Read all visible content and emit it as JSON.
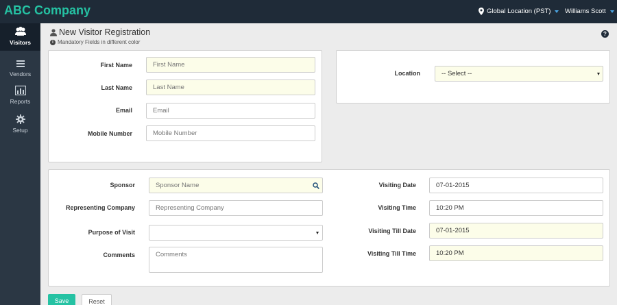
{
  "header": {
    "brand": "ABC Company",
    "location": "Global Location (PST)",
    "user": "Williams Scott"
  },
  "sidebar": {
    "items": [
      {
        "label": "Visitors",
        "icon": "users-icon",
        "active": true
      },
      {
        "label": "Vendors",
        "icon": "list-icon",
        "active": false
      },
      {
        "label": "Reports",
        "icon": "bar-chart-icon",
        "active": false
      },
      {
        "label": "Setup",
        "icon": "gear-icon",
        "active": false
      }
    ]
  },
  "page": {
    "title": "New Visitor Registration",
    "subtitle": "Mandatory Fields in different color",
    "help": "?"
  },
  "visitor_form": {
    "first_name": {
      "label": "First Name",
      "placeholder": "First Name"
    },
    "last_name": {
      "label": "Last Name",
      "placeholder": "Last Name"
    },
    "email": {
      "label": "Email",
      "placeholder": "Email"
    },
    "mobile": {
      "label": "Mobile Number",
      "placeholder": "Mobile Number"
    }
  },
  "location_form": {
    "label": "Location",
    "value": "-- Select --"
  },
  "visit_form": {
    "sponsor": {
      "label": "Sponsor",
      "placeholder": "Sponsor Name"
    },
    "company": {
      "label": "Representing Company",
      "placeholder": "Representing Company"
    },
    "purpose": {
      "label": "Purpose of Visit",
      "value": ""
    },
    "comments": {
      "label": "Comments",
      "placeholder": "Comments"
    },
    "visiting_date": {
      "label": "Visiting Date",
      "value": "07-01-2015"
    },
    "visiting_time": {
      "label": "Visiting Time",
      "value": "10:20 PM"
    },
    "till_date": {
      "label": "Visiting Till Date",
      "value": "07-01-2015"
    },
    "till_time": {
      "label": "Visiting Till Time",
      "value": "10:20 PM"
    }
  },
  "actions": {
    "save": "Save",
    "reset": "Reset"
  },
  "colors": {
    "brand": "#25c2a3",
    "topbar": "#1f2b38",
    "mandatory_bg": "#fcfde9"
  }
}
